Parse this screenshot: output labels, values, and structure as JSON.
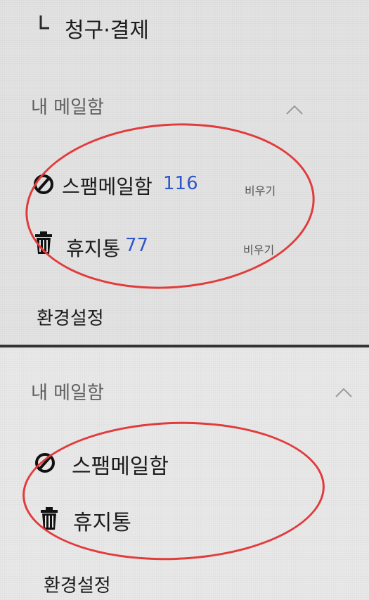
{
  "top_panel": {
    "sub_item": {
      "label": "청구·결제"
    },
    "section": {
      "title": "내 메일함"
    },
    "items": [
      {
        "label": "스팸메일함",
        "count": "116",
        "action": "비우기",
        "icon": "blocked-icon"
      },
      {
        "label": "휴지통",
        "count": "77",
        "action": "비우기",
        "icon": "trash-icon"
      }
    ],
    "settings": {
      "label": "환경설정"
    }
  },
  "bottom_panel": {
    "section": {
      "title": "내 메일함"
    },
    "items": [
      {
        "label": "스팸메일함",
        "icon": "blocked-icon"
      },
      {
        "label": "휴지통",
        "icon": "trash-icon"
      }
    ],
    "settings": {
      "label": "환경설정"
    }
  },
  "colors": {
    "highlight_circle": "#e23b3b",
    "count_text": "#2f56c8"
  }
}
